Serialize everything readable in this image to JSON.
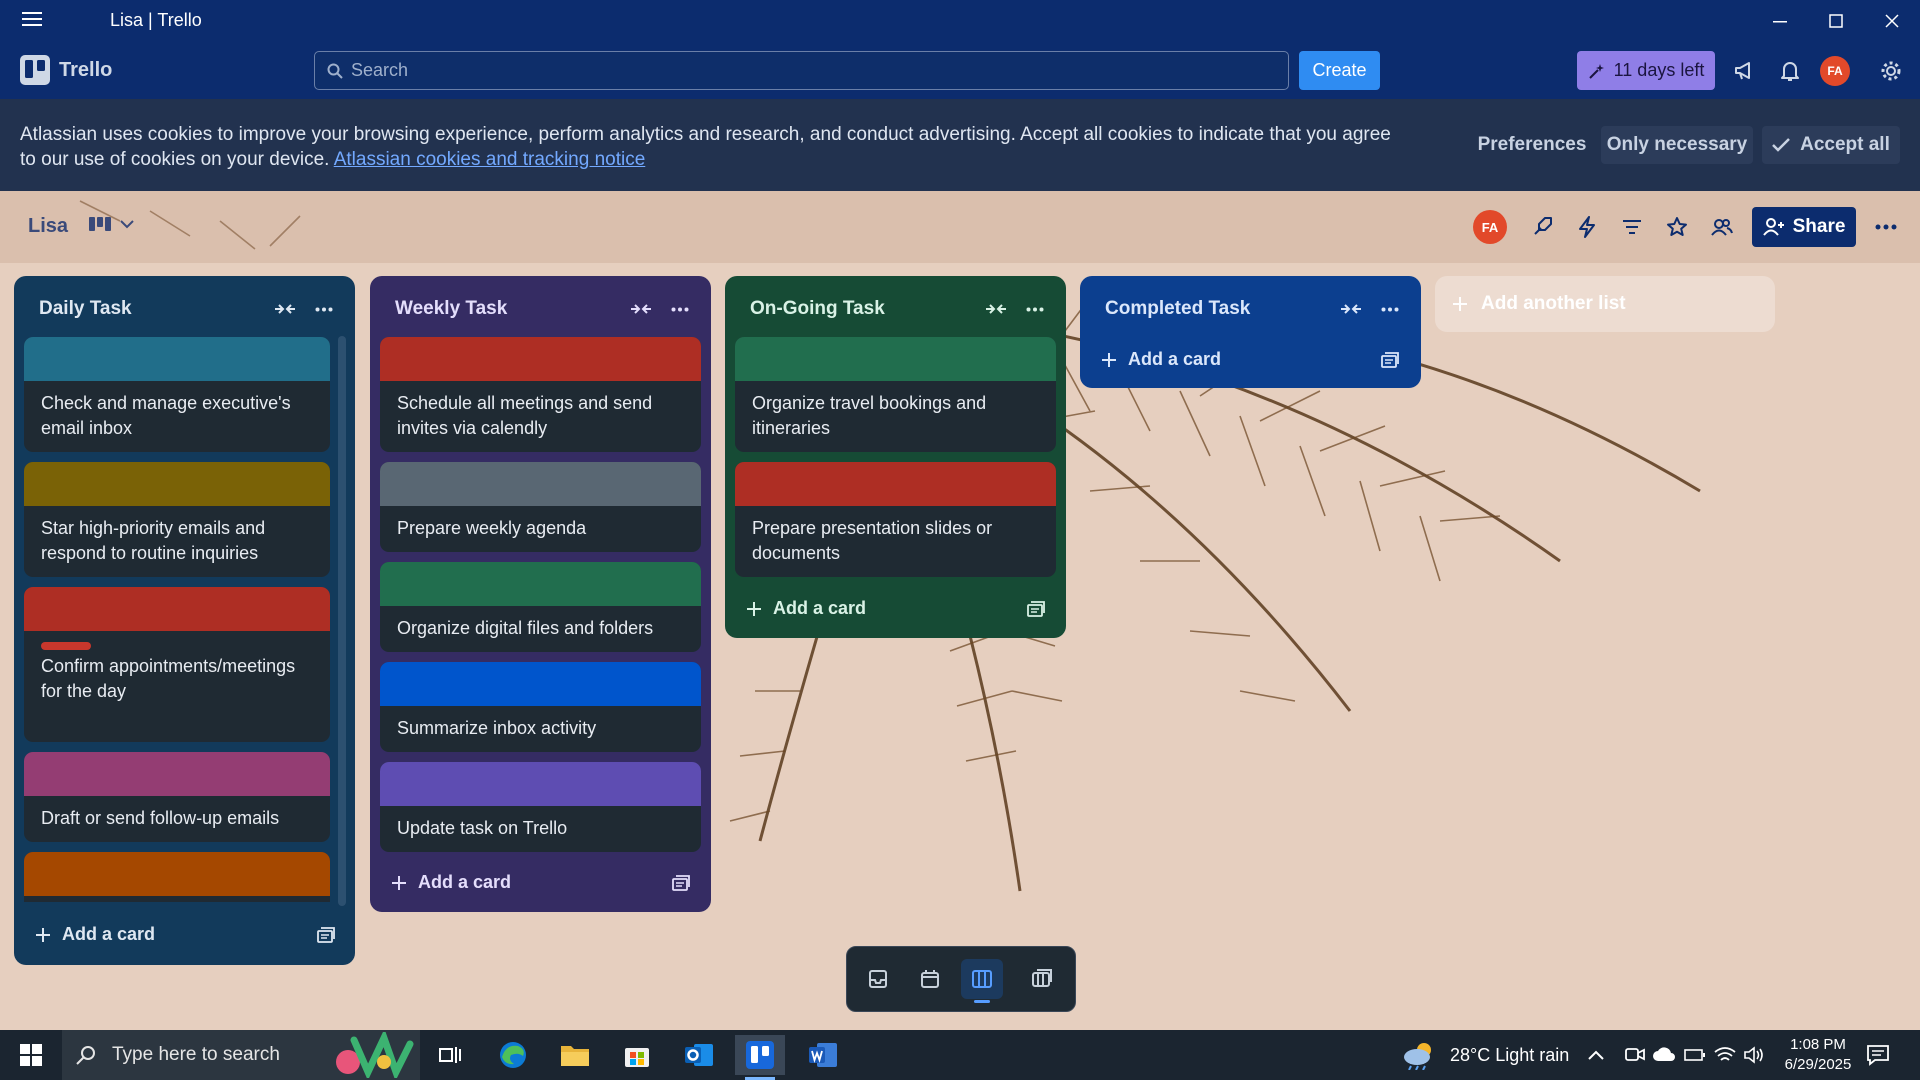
{
  "window": {
    "title": "Lisa | Trello"
  },
  "header": {
    "app_name": "Trello",
    "search_placeholder": "Search",
    "create_label": "Create",
    "trial_label": "11 days left",
    "avatar_initials": "FA"
  },
  "cookie": {
    "text": "Atlassian uses cookies to improve your browsing experience, perform analytics and research, and conduct advertising. Accept all cookies to indicate that you agree to our use of cookies on your device.",
    "link": "Atlassian cookies and tracking notice",
    "preferences": "Preferences",
    "only_necessary": "Only necessary",
    "accept_all": "Accept all"
  },
  "board": {
    "name": "Lisa",
    "share_label": "Share",
    "member_initials": "FA"
  },
  "lists": [
    {
      "title": "Daily Task",
      "color": "#123a5b",
      "text_color": "#dfe8f2",
      "add_label": "Add a card",
      "cards": [
        {
          "cover": "#216e8a",
          "title": "Check and manage executive's email inbox"
        },
        {
          "cover": "#7a6206",
          "title": "Star high-priority emails and respond to routine inquiries"
        },
        {
          "cover": "#ae2e24",
          "title": "Confirm appointments/meetings for the day",
          "label_color": "#c9372c"
        },
        {
          "cover": "#943d73",
          "title": "Draft or send follow-up emails"
        },
        {
          "cover": "#a54800",
          "title": ""
        }
      ]
    },
    {
      "title": "Weekly Task",
      "color": "#352c63",
      "text_color": "#e4defc",
      "add_label": "Add a card",
      "cards": [
        {
          "cover": "#ae2e24",
          "title": "Schedule all meetings and send invites via calendly"
        },
        {
          "cover": "#596773",
          "title": "Prepare weekly agenda"
        },
        {
          "cover": "#216e4e",
          "title": "Organize digital files and folders"
        },
        {
          "cover": "#0055cc",
          "title": "Summarize inbox activity"
        },
        {
          "cover": "#5e4db2",
          "title": "Update task on Trello"
        }
      ]
    },
    {
      "title": "On-Going Task",
      "color": "#164b35",
      "text_color": "#d9f2e6",
      "add_label": "Add a card",
      "cards": [
        {
          "cover": "#216e4e",
          "title": "Organize travel bookings and itineraries"
        },
        {
          "cover": "#ae2e24",
          "title": "Prepare presentation slides or documents"
        }
      ]
    },
    {
      "title": "Completed Task",
      "color": "#0c3f8f",
      "text_color": "#dbe7fb",
      "add_label": "Add a card",
      "cards": []
    }
  ],
  "add_list_label": "Add another list",
  "taskbar": {
    "search_placeholder": "Type here to search",
    "weather": "28°C  Light rain",
    "time": "1:08 PM",
    "date": "6/29/2025"
  }
}
